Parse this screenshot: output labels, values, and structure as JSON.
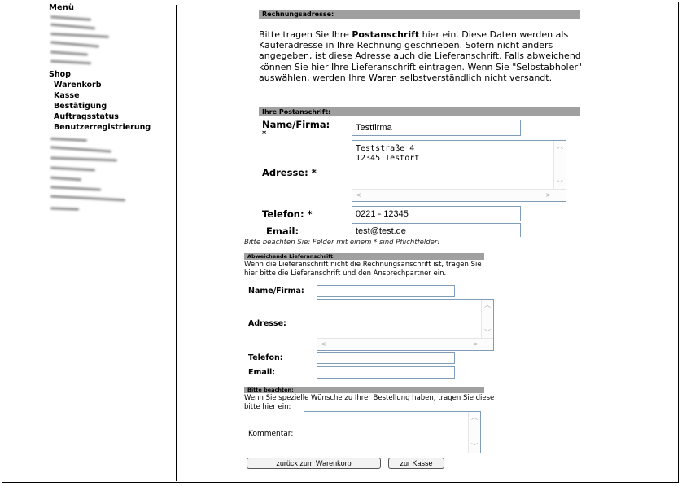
{
  "sidebar": {
    "menu_title": "Menü",
    "shop_label": "Shop",
    "shop_items": [
      {
        "label": "Warenkorb"
      },
      {
        "label": "Kasse"
      },
      {
        "label": "Bestätigung"
      },
      {
        "label": "Auftragsstatus"
      },
      {
        "label": "Benutzerregistrierung"
      }
    ]
  },
  "billing": {
    "section_title": "Rechnungsadresse:",
    "intro_before": "Bitte tragen Sie Ihre ",
    "intro_bold": "Postanschrift",
    "intro_after": " hier ein. Diese Daten werden als Käuferadresse in Ihre Rechnung geschrieben. Sofern nicht anders angegeben, ist diese Adresse auch die Lieferanschrift. Falls abweichend können Sie hier Ihre Lieferanschrift eintragen. Wenn Sie \"Selbstabholer\" auswählen, werden Ihre Waren selbstverständlich nicht versandt.",
    "subsection_title": "Ihre Postanschrift:",
    "name_label": "Name/Firma:",
    "name_required": "*",
    "name_value": "Testfirma",
    "address_label": "Adresse: *",
    "address_value": "Teststraße 4\n12345 Testort",
    "phone_label": "Telefon: *",
    "phone_value": "0221 - 12345",
    "email_label": "Email:",
    "email_value": "test@test.de",
    "required_note": "Bitte beachten Sie: Felder mit einem * sind Pflichtfelder!"
  },
  "delivery": {
    "section_title": "Abweichende Lieferanschrift:",
    "intro": "Wenn die Lieferanschrift nicht die Rechnungsanschrift ist, tragen Sie hier bitte die Lieferanschrift und den Ansprechpartner ein.",
    "name_label": "Name/Firma:",
    "address_label": "Adresse:",
    "phone_label": "Telefon:",
    "email_label": "Email:"
  },
  "notes": {
    "section_title": "Bitte beachten:",
    "intro": "Wenn Sie spezielle Wünsche zu Ihrer Bestellung haben, tragen Sie diese bitte hier ein:",
    "comment_label": "Kommentar:"
  },
  "buttons": {
    "back_label": "zurück zum Warenkorb",
    "checkout_label": "zur Kasse"
  }
}
